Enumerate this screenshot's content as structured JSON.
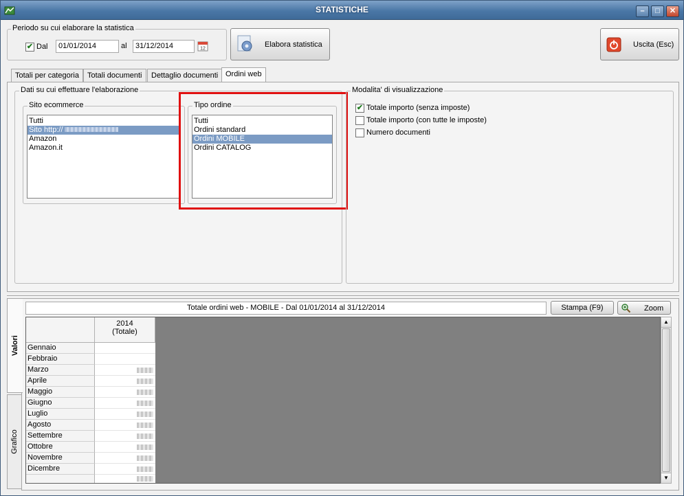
{
  "window": {
    "title": "STATISTICHE"
  },
  "period": {
    "legend": "Periodo su cui elaborare la statistica",
    "checkbox_label": "Dal",
    "checkbox_checked": true,
    "from_value": "01/01/2014",
    "to_label": "al",
    "to_value": "31/12/2014"
  },
  "buttons": {
    "elabora": "Elabora statistica",
    "uscita": "Uscita (Esc)",
    "stampa": "Stampa (F9)",
    "zoom": "Zoom"
  },
  "tabs": [
    {
      "label": "Totali per categoria",
      "active": false
    },
    {
      "label": "Totali documenti",
      "active": false
    },
    {
      "label": "Dettaglio documenti",
      "active": false
    },
    {
      "label": "Ordini web",
      "active": true
    }
  ],
  "dati": {
    "legend": "Dati su cui effettuare l'elaborazione",
    "sito": {
      "legend": "Sito ecommerce",
      "items": [
        "Tutti",
        "Sito http://",
        "Amazon",
        "Amazon.it"
      ],
      "selected_index": 1
    },
    "tipo": {
      "legend": "Tipo ordine",
      "items": [
        "Tutti",
        "Ordini standard",
        "Ordini MOBILE",
        "Ordini CATALOG"
      ],
      "selected_index": 2
    }
  },
  "modalita": {
    "legend": "Modalita' di visualizzazione",
    "options": [
      {
        "label": "Totale importo (senza imposte)",
        "checked": true
      },
      {
        "label": "Totale importo (con tutte le imposte)",
        "checked": false
      },
      {
        "label": "Numero documenti",
        "checked": false
      }
    ]
  },
  "results": {
    "caption": "Totale ordini web - MOBILE - Dal 01/01/2014 al 31/12/2014",
    "side_tabs": [
      "Valori",
      "Grafico"
    ],
    "column_header_line1": "2014",
    "column_header_line2": "(Totale)",
    "months": [
      "Gennaio",
      "Febbraio",
      "Marzo",
      "Aprile",
      "Maggio",
      "Giugno",
      "Luglio",
      "Agosto",
      "Settembre",
      "Ottobre",
      "Novembre",
      "Dicembre"
    ]
  },
  "colors": {
    "highlight_border": "#e01010",
    "selection": "#7b9bc4",
    "grid_background": "#808080"
  }
}
